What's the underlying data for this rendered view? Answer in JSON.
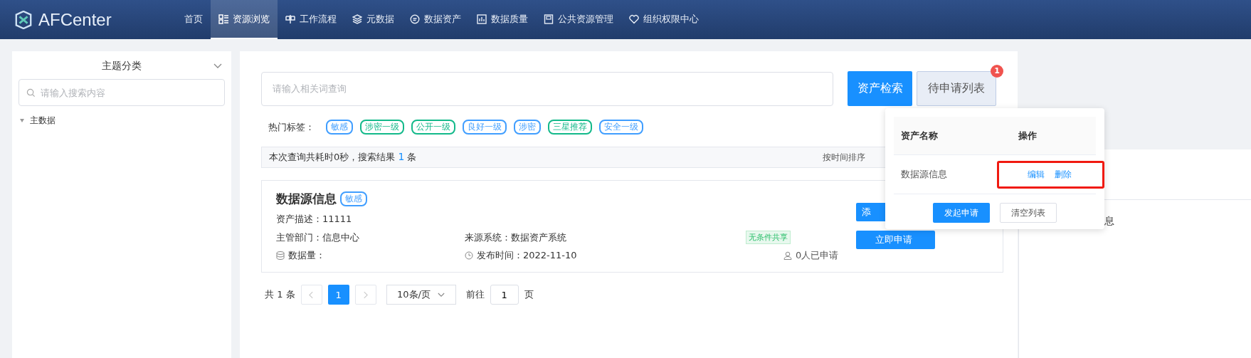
{
  "header": {
    "logo": "AFCenter",
    "nav": [
      {
        "label": "首页",
        "selected": false
      },
      {
        "label": "资源浏览",
        "selected": true
      },
      {
        "label": "工作流程",
        "selected": false
      },
      {
        "label": "元数据",
        "selected": false
      },
      {
        "label": "数据资产",
        "selected": false
      },
      {
        "label": "数据质量",
        "selected": false
      },
      {
        "label": "公共资源管理",
        "selected": false
      },
      {
        "label": "组织权限中心",
        "selected": false
      }
    ]
  },
  "sidebar": {
    "title": "主题分类",
    "search_placeholder": "请输入搜索内容",
    "tree": [
      {
        "label": "主数据",
        "expanded": true
      }
    ]
  },
  "search": {
    "placeholder": "请输入相关词查询",
    "search_button": "资产检索",
    "list_button": "待申请列表",
    "badge": "1"
  },
  "hot_tags": {
    "label": "热门标签：",
    "tags": [
      {
        "text": "敏感",
        "color": "#409eff"
      },
      {
        "text": "涉密一级",
        "color": "#13b98a"
      },
      {
        "text": "公开一级",
        "color": "#13b98a"
      },
      {
        "text": "良好一级",
        "color": "#409eff"
      },
      {
        "text": "涉密",
        "color": "#409eff"
      },
      {
        "text": "三星推荐",
        "color": "#13b98a"
      },
      {
        "text": "安全一级",
        "color": "#409eff"
      }
    ]
  },
  "result_bar": {
    "prefix": "本次查询共耗时0秒，搜索结果",
    "count": "1",
    "suffix": "条",
    "sort": "按时间排序"
  },
  "results": [
    {
      "title": "数据源信息",
      "tag": "敏感",
      "description": "资产描述：11111",
      "department": "主管部门：信息中心",
      "source": "来源系统：数据资产系统",
      "share": "无条件共享",
      "volume": "数据量：",
      "published": "发布时间：2022-11-10",
      "applicants": "0人已申请",
      "buttons": [
        "添",
        "立即申请"
      ]
    }
  ],
  "pagination": {
    "total": "共 1 条",
    "pages": [
      {
        "label": "1",
        "selected": true
      }
    ],
    "page_size": "10条/页",
    "goto_label": "前往",
    "goto_value": "1",
    "page_suffix": "页"
  },
  "right_panel": {
    "text": "息"
  },
  "popover": {
    "columns": [
      "资产名称",
      "操作"
    ],
    "rows": [
      {
        "name": "数据源信息",
        "actions": [
          "编辑",
          "删除"
        ],
        "highlighted": true
      }
    ],
    "buttons": [
      "发起申请",
      "清空列表"
    ]
  }
}
